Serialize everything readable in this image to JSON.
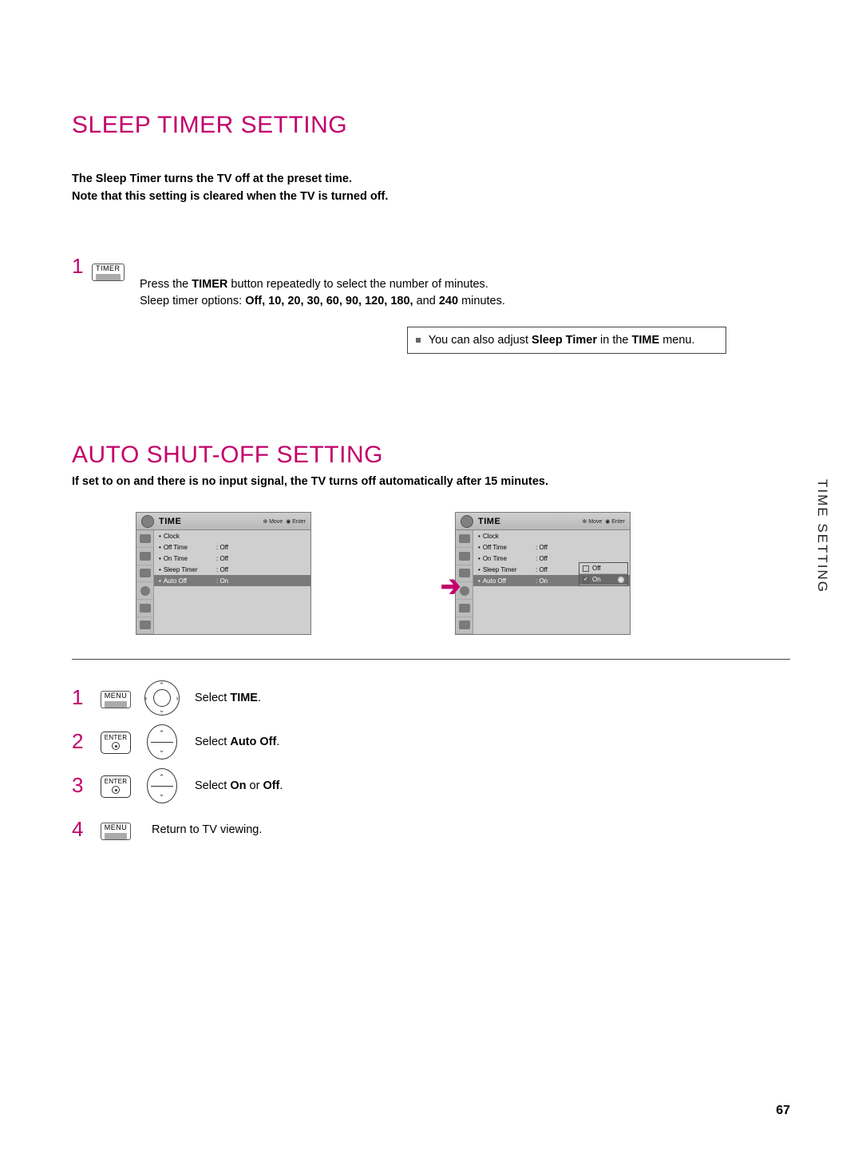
{
  "page_number": "67",
  "side_tab": "TIME SETTING",
  "section1": {
    "title": "SLEEP TIMER SETTING",
    "intro_l1": "The Sleep Timer turns the TV off at the preset time.",
    "intro_l2": "Note that this setting is cleared when the TV is turned off.",
    "step_num": "1",
    "timer_btn": "TIMER",
    "desc_pre": "Press the ",
    "desc_bold": "TIMER",
    "desc_post": " button repeatedly to select the number of minutes.",
    "options_pre": "Sleep timer options: ",
    "options_bold": "Off, 10, 20, 30, 60, 90, 120, 180,",
    "options_post": " and ",
    "options_last": "240",
    "options_tail": " minutes.",
    "note_pre": "You can also adjust ",
    "note_b1": "Sleep Timer",
    "note_mid": " in the ",
    "note_b2": "TIME",
    "note_post": " menu."
  },
  "section2": {
    "title": "AUTO SHUT-OFF SETTING",
    "sub": "If set to on and there is no input signal, the TV turns off automatically after 15 minutes."
  },
  "osd": {
    "title": "TIME",
    "hint_move": "Move",
    "hint_enter": "Enter",
    "rows": [
      {
        "label": "Clock",
        "val": ""
      },
      {
        "label": "Off Time",
        "val": ": Off"
      },
      {
        "label": "On Time",
        "val": ": Off"
      },
      {
        "label": "Sleep Timer",
        "val": ": Off"
      },
      {
        "label": "Auto Off",
        "val": ": On"
      }
    ],
    "popup": {
      "off": "Off",
      "on": "On"
    }
  },
  "steps": {
    "s1": {
      "num": "1",
      "btn": "MENU",
      "desc_pre": "Select ",
      "desc_b": "TIME",
      "desc_post": "."
    },
    "s2": {
      "num": "2",
      "btn": "ENTER",
      "desc_pre": "Select ",
      "desc_b": "Auto Off",
      "desc_post": "."
    },
    "s3": {
      "num": "3",
      "btn": "ENTER",
      "desc_pre": "Select ",
      "desc_b1": "On",
      "desc_mid": " or ",
      "desc_b2": "Off",
      "desc_post": "."
    },
    "s4": {
      "num": "4",
      "btn": "MENU",
      "desc": "Return to TV viewing."
    }
  }
}
